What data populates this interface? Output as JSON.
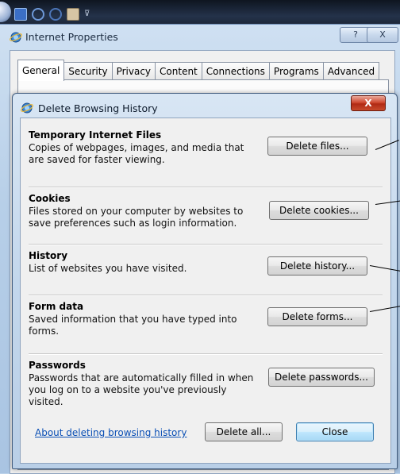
{
  "quick_access": {
    "icons": [
      "office-orb-icon",
      "save-icon",
      "undo-icon",
      "redo-icon",
      "format-icon",
      "customize-dropdown-icon"
    ],
    "dropdown_glyph": "⊽"
  },
  "internet_properties": {
    "title": "Internet Properties",
    "help_button": "?",
    "close_button": "X",
    "tabs": [
      "General",
      "Security",
      "Privacy",
      "Content",
      "Connections",
      "Programs",
      "Advanced"
    ],
    "active_tab": "General"
  },
  "dialog": {
    "title": "Delete Browsing History",
    "close_glyph": "X",
    "sections": [
      {
        "heading": "Temporary Internet Files",
        "description": "Copies of webpages, images, and media that are saved for faster viewing.",
        "button": "Delete files..."
      },
      {
        "heading": "Cookies",
        "description": "Files stored on your computer by websites to save preferences such as login information.",
        "button": "Delete cookies..."
      },
      {
        "heading": "History",
        "description": "List of websites you have visited.",
        "button": "Delete history..."
      },
      {
        "heading": "Form data",
        "description": "Saved information that you have typed into forms.",
        "button": "Delete forms..."
      },
      {
        "heading": "Passwords",
        "description": "Passwords that are automatically filled in when you log on to a website you've previously visited.",
        "button": "Delete passwords..."
      }
    ],
    "about_link": "About deleting browsing history",
    "delete_all_button": "Delete all...",
    "close_button": "Close"
  }
}
